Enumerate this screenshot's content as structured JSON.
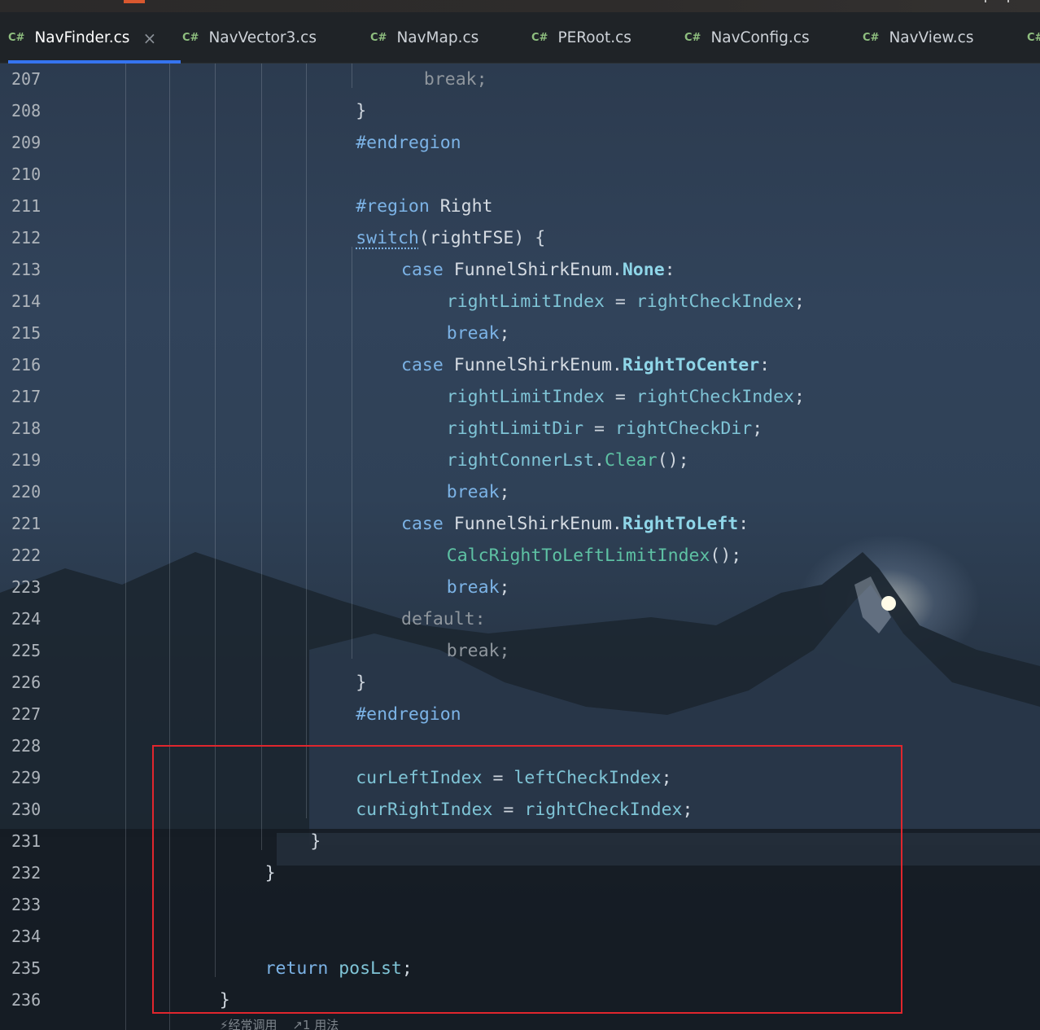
{
  "tabs": [
    {
      "label": "NavFinder.cs",
      "icon": "C#",
      "active": true
    },
    {
      "label": "NavVector3.cs",
      "icon": "C#"
    },
    {
      "label": "NavMap.cs",
      "icon": "C#"
    },
    {
      "label": "PERoot.cs",
      "icon": "C#"
    },
    {
      "label": "NavConfig.cs",
      "icon": "C#"
    },
    {
      "label": "NavView.cs",
      "icon": "C#"
    },
    {
      "label": "",
      "icon": "C#"
    }
  ],
  "close_glyph": "×",
  "lines": [
    {
      "n": "207",
      "indent": 11,
      "tokens": [
        [
          "break;",
          "t-dim"
        ]
      ]
    },
    {
      "n": "208",
      "indent": 8,
      "tokens": [
        [
          "}",
          "t-punc"
        ]
      ]
    },
    {
      "n": "209",
      "indent": 8,
      "tokens": [
        [
          "#endregion",
          "t-dir"
        ]
      ]
    },
    {
      "n": "210",
      "indent": 0,
      "tokens": []
    },
    {
      "n": "211",
      "indent": 8,
      "tokens": [
        [
          "#region",
          "t-dir"
        ],
        [
          " Right",
          "t-plain"
        ]
      ]
    },
    {
      "n": "212",
      "indent": 8,
      "tokens": [
        [
          "switch",
          "t-kw t-squig"
        ],
        [
          "(",
          "t-punc"
        ],
        [
          "rightFSE",
          "t-plain"
        ],
        [
          ") {",
          "t-punc"
        ]
      ]
    },
    {
      "n": "213",
      "indent": 10,
      "tokens": [
        [
          "case ",
          "t-kw"
        ],
        [
          "FunnelShirkEnum",
          "t-type"
        ],
        [
          ".",
          "t-punc"
        ],
        [
          "None",
          "t-enum"
        ],
        [
          ":",
          "t-punc"
        ]
      ]
    },
    {
      "n": "214",
      "indent": 12,
      "tokens": [
        [
          "rightLimitIndex",
          "t-id"
        ],
        [
          " = ",
          "t-punc"
        ],
        [
          "rightCheckIndex",
          "t-id"
        ],
        [
          ";",
          "t-punc"
        ]
      ]
    },
    {
      "n": "215",
      "indent": 12,
      "tokens": [
        [
          "break",
          "t-kw"
        ],
        [
          ";",
          "t-punc"
        ]
      ]
    },
    {
      "n": "216",
      "indent": 10,
      "tokens": [
        [
          "case ",
          "t-kw"
        ],
        [
          "FunnelShirkEnum",
          "t-type"
        ],
        [
          ".",
          "t-punc"
        ],
        [
          "RightToCenter",
          "t-enum"
        ],
        [
          ":",
          "t-punc"
        ]
      ]
    },
    {
      "n": "217",
      "indent": 12,
      "tokens": [
        [
          "rightLimitIndex",
          "t-id"
        ],
        [
          " = ",
          "t-punc"
        ],
        [
          "rightCheckIndex",
          "t-id"
        ],
        [
          ";",
          "t-punc"
        ]
      ]
    },
    {
      "n": "218",
      "indent": 12,
      "tokens": [
        [
          "rightLimitDir",
          "t-id"
        ],
        [
          " = ",
          "t-punc"
        ],
        [
          "rightCheckDir",
          "t-id"
        ],
        [
          ";",
          "t-punc"
        ]
      ]
    },
    {
      "n": "219",
      "indent": 12,
      "tokens": [
        [
          "rightConnerLst",
          "t-id"
        ],
        [
          ".",
          "t-punc"
        ],
        [
          "Clear",
          "t-method"
        ],
        [
          "();",
          "t-punc"
        ]
      ]
    },
    {
      "n": "220",
      "indent": 12,
      "tokens": [
        [
          "break",
          "t-kw"
        ],
        [
          ";",
          "t-punc"
        ]
      ]
    },
    {
      "n": "221",
      "indent": 10,
      "tokens": [
        [
          "case ",
          "t-kw"
        ],
        [
          "FunnelShirkEnum",
          "t-type"
        ],
        [
          ".",
          "t-punc"
        ],
        [
          "RightToLeft",
          "t-enum"
        ],
        [
          ":",
          "t-punc"
        ]
      ]
    },
    {
      "n": "222",
      "indent": 12,
      "tokens": [
        [
          "CalcRightToLeftLimitIndex",
          "t-method"
        ],
        [
          "();",
          "t-punc"
        ]
      ]
    },
    {
      "n": "223",
      "indent": 12,
      "tokens": [
        [
          "break",
          "t-kw"
        ],
        [
          ";",
          "t-punc"
        ]
      ]
    },
    {
      "n": "224",
      "indent": 10,
      "tokens": [
        [
          "default:",
          "t-dim"
        ]
      ]
    },
    {
      "n": "225",
      "indent": 12,
      "tokens": [
        [
          "break;",
          "t-dim"
        ]
      ]
    },
    {
      "n": "226",
      "indent": 8,
      "tokens": [
        [
          "}",
          "t-punc"
        ]
      ]
    },
    {
      "n": "227",
      "indent": 8,
      "tokens": [
        [
          "#endregion",
          "t-dir"
        ]
      ]
    },
    {
      "n": "228",
      "indent": 0,
      "tokens": []
    },
    {
      "n": "229",
      "indent": 8,
      "tokens": [
        [
          "curLeftIndex",
          "t-id"
        ],
        [
          " = ",
          "t-punc"
        ],
        [
          "leftCheckIndex",
          "t-id"
        ],
        [
          ";",
          "t-punc"
        ]
      ]
    },
    {
      "n": "230",
      "indent": 8,
      "tokens": [
        [
          "curRightIndex",
          "t-id"
        ],
        [
          " = ",
          "t-punc"
        ],
        [
          "rightCheckIndex",
          "t-id"
        ],
        [
          ";",
          "t-punc"
        ]
      ]
    },
    {
      "n": "231",
      "indent": 6,
      "tokens": [
        [
          "}",
          "t-punc"
        ]
      ]
    },
    {
      "n": "232",
      "indent": 4,
      "tokens": [
        [
          "}",
          "t-punc"
        ]
      ]
    },
    {
      "n": "233",
      "indent": 0,
      "tokens": []
    },
    {
      "n": "234",
      "indent": 0,
      "tokens": []
    },
    {
      "n": "235",
      "indent": 4,
      "tokens": [
        [
          "return ",
          "t-kw"
        ],
        [
          "posLst",
          "t-id"
        ],
        [
          ";",
          "t-punc"
        ]
      ]
    },
    {
      "n": "236",
      "indent": 2,
      "tokens": [
        [
          "}",
          "t-punc"
        ]
      ]
    }
  ],
  "footer_hint": {
    "usage": "⚡经常调用",
    "refs": "↗1 用法"
  },
  "colors": {
    "accent_tab": "#3574f0",
    "highlight_box": "#e0262d"
  }
}
